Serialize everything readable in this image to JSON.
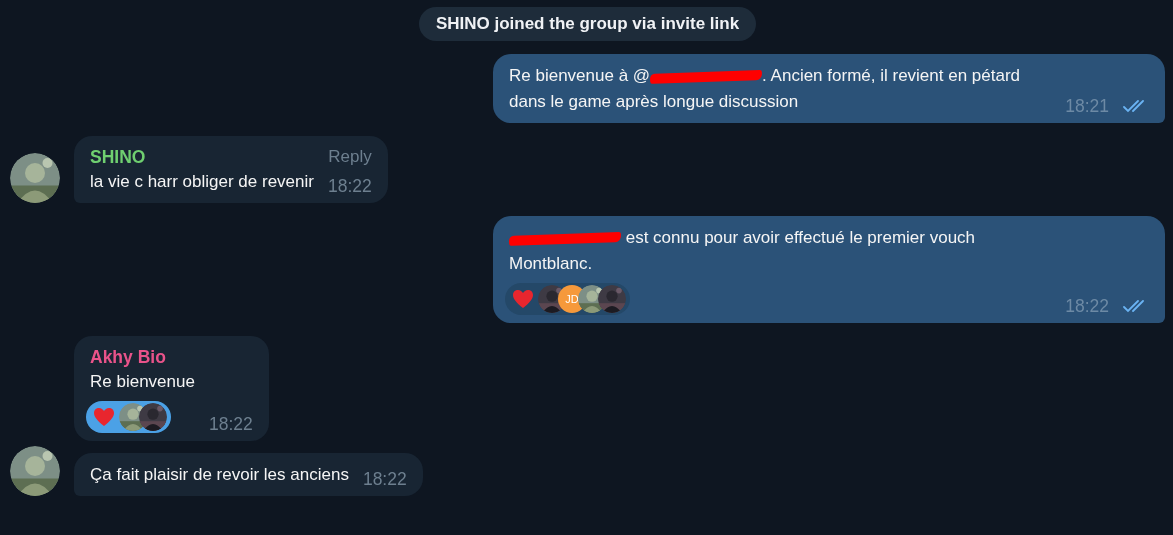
{
  "service_message": "SHINO joined the group via invite link",
  "messages": [
    {
      "kind": "outgoing",
      "parts": [
        {
          "kind": "text",
          "text": "Re bienvenue à @"
        },
        {
          "kind": "redacted"
        },
        {
          "kind": "text",
          "text": ". Ancien formé, il revient en pétard dans le game après longue discussion"
        }
      ],
      "time": "18:21",
      "read": true
    },
    {
      "kind": "incoming",
      "sender": "SHINO",
      "color": "#6fcf70",
      "avatar": true,
      "reply_label": "Reply",
      "parts": [
        {
          "kind": "text",
          "text": "la vie c harr obliger de revenir"
        }
      ],
      "time": "18:22"
    },
    {
      "kind": "outgoing",
      "parts": [
        {
          "kind": "redacted"
        },
        {
          "kind": "text",
          "text": " est connu pour avoir effectué le premier vouch Montblanc."
        }
      ],
      "reaction": {
        "selected": false,
        "reactors": [
          {
            "kind": "picture"
          },
          {
            "kind": "initials",
            "initials": "JD",
            "color": "#f6993b"
          },
          {
            "kind": "picture"
          },
          {
            "kind": "picture"
          }
        ]
      },
      "time": "18:22",
      "read": true
    },
    {
      "kind": "incoming",
      "sender": "Akhy Bio",
      "color": "#e9538a",
      "avatar": false,
      "parts": [
        {
          "kind": "text",
          "text": "Re bienvenue"
        }
      ],
      "reaction": {
        "selected": true,
        "reactors": [
          {
            "kind": "picture"
          },
          {
            "kind": "picture"
          }
        ]
      },
      "time": "18:22"
    },
    {
      "kind": "incoming",
      "avatar": true,
      "parts": [
        {
          "kind": "text",
          "text": "Ça fait plaisir de revoir les anciens"
        }
      ],
      "time": "18:22"
    }
  ]
}
